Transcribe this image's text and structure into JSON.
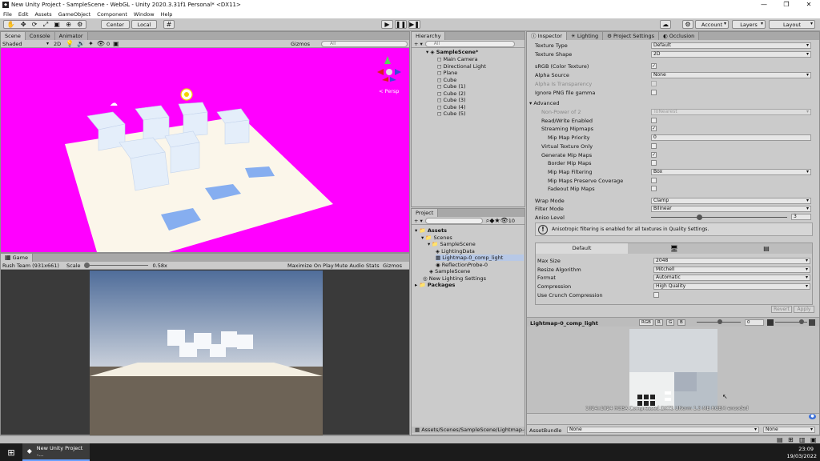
{
  "window": {
    "title": "New Unity Project - SampleScene - WebGL - Unity 2020.3.31f1 Personal* <DX11>"
  },
  "menu": [
    "File",
    "Edit",
    "Assets",
    "GameObject",
    "Component",
    "Window",
    "Help"
  ],
  "toolbar": {
    "center": "Center",
    "local": "Local",
    "account": "Account",
    "layers": "Layers",
    "layout": "Layout"
  },
  "scene": {
    "tabs": [
      "Scene",
      "Console",
      "Animator"
    ],
    "shaded": "Shaded",
    "mode2d": "2D",
    "gizmos": "Gizmos",
    "search_placeholder": "All",
    "count": "0",
    "persp": "< Persp"
  },
  "game": {
    "tab": "Game",
    "resolution": "Rush Team (931x661)",
    "scale_label": "Scale",
    "scale_value": "0.58x",
    "maximize": "Maximize On Play",
    "mute": "Mute Audio",
    "stats": "Stats",
    "gizmos": "Gizmos"
  },
  "hierarchy": {
    "tab": "Hierarchy",
    "search_placeholder": "All",
    "scene": "SampleScene*",
    "items": [
      "Main Camera",
      "Directional Light",
      "Plane",
      "Cube",
      "Cube (1)",
      "Cube (2)",
      "Cube (3)",
      "Cube (4)",
      "Cube (5)"
    ]
  },
  "project": {
    "tab": "Project",
    "count": "10",
    "assets": "Assets",
    "scenes": "Scenes",
    "samplescene_folder": "SampleScene",
    "files": [
      "LightingData",
      "Lightmap-0_comp_light",
      "ReflectionProbe-0"
    ],
    "samplescene": "SampleScene",
    "lighting": "New Lighting Settings",
    "packages": "Packages",
    "path": "Assets/Scenes/SampleScene/Lightmap-0_..."
  },
  "inspector": {
    "tabs": [
      "Inspector",
      "Lighting",
      "Project Settings",
      "Occlusion"
    ],
    "texture_type": {
      "label": "Texture Type",
      "value": "Default"
    },
    "texture_shape": {
      "label": "Texture Shape",
      "value": "2D"
    },
    "srgb": {
      "label": "sRGB (Color Texture)",
      "checked": "✓"
    },
    "alpha_source": {
      "label": "Alpha Source",
      "value": "None"
    },
    "alpha_transparency": {
      "label": "Alpha Is Transparency"
    },
    "ignore_png": {
      "label": "Ignore PNG file gamma"
    },
    "advanced": "Advanced",
    "non_power": {
      "label": "Non-Power of 2",
      "value": "ToNearest"
    },
    "read_write": {
      "label": "Read/Write Enabled"
    },
    "streaming": {
      "label": "Streaming Mipmaps",
      "checked": "✓"
    },
    "mip_priority": {
      "label": "Mip Map Priority",
      "value": "0"
    },
    "virtual": {
      "label": "Virtual Texture Only"
    },
    "gen_mip": {
      "label": "Generate Mip Maps",
      "checked": "✓"
    },
    "border_mip": {
      "label": "Border Mip Maps"
    },
    "mip_filter": {
      "label": "Mip Map Filtering",
      "value": "Box"
    },
    "mip_coverage": {
      "label": "Mip Maps Preserve Coverage"
    },
    "fadeout": {
      "label": "Fadeout Mip Maps"
    },
    "wrap": {
      "label": "Wrap Mode",
      "value": "Clamp"
    },
    "filter": {
      "label": "Filter Mode",
      "value": "Bilinear"
    },
    "aniso": {
      "label": "Aniso Level",
      "value": "3",
      "level": 0.35
    },
    "notice": "Anisotropic filtering is enabled for all textures in Quality Settings.",
    "platform_default": "Default",
    "max_size": {
      "label": "Max Size",
      "value": "2048"
    },
    "resize": {
      "label": "Resize Algorithm",
      "value": "Mitchell"
    },
    "format": {
      "label": "Format",
      "value": "Automatic"
    },
    "compression": {
      "label": "Compression",
      "value": "High Quality"
    },
    "crunch": {
      "label": "Use Crunch Compression"
    },
    "revert": "Revert",
    "apply": "Apply"
  },
  "preview": {
    "title": "Lightmap-0_comp_light",
    "channels": [
      "RGB",
      "R",
      "G",
      "B"
    ],
    "mip": "0",
    "info": "1024x1024 RGBA Compressed DXT5 UNorm 1.3 MB RGBM encoded"
  },
  "assetbundle": {
    "label": "AssetBundle",
    "value": "None",
    "variant": "None"
  },
  "taskbar": {
    "app": "New Unity Project -...",
    "time": "23:09",
    "date": "19/03/2022"
  },
  "colors": {
    "scene_bg": "#ff00ff",
    "accent": "#3a6fd8"
  }
}
